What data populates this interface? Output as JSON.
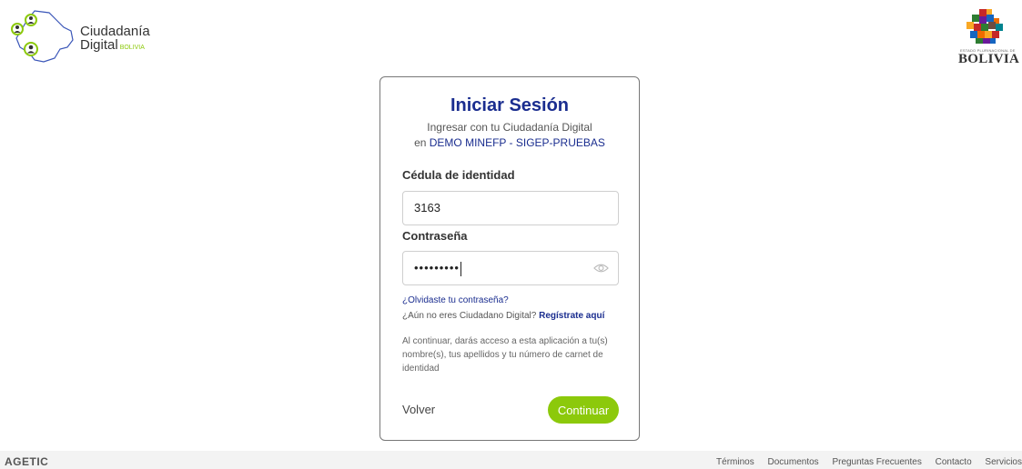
{
  "header": {
    "brand_line1": "Ciudadanía",
    "brand_line2": "Digital",
    "brand_tag": "BOLIVIA",
    "right_logo_small": "ESTADO PLURINACIONAL DE",
    "right_logo_text": "BOLIVIA"
  },
  "login": {
    "title": "Iniciar Sesión",
    "subtitle": "Ingresar con tu Ciudadanía Digital",
    "app_prefix": "en",
    "app_name": "DEMO MINEFP - SIGEP-PRUEBAS",
    "ci_label": "Cédula de identidad",
    "ci_value": "3163",
    "password_label": "Contraseña",
    "password_masked": "•••••••••",
    "forgot_link": "¿Olvidaste tu contraseña?",
    "register_prompt": "¿Aún no eres Ciudadano Digital?",
    "register_link": "Regístrate aquí",
    "consent_text": "Al continuar, darás acceso a esta aplicación a tu(s) nombre(s), tus apellidos y tu número de carnet de identidad",
    "back_label": "Volver",
    "continue_label": "Continuar"
  },
  "footer": {
    "org": "AGETIC",
    "links": [
      "Términos",
      "Documentos",
      "Preguntas Frecuentes",
      "Contacto",
      "Servicios"
    ]
  },
  "colors": {
    "primary": "#1a2d8f",
    "accent": "#8cc90b"
  },
  "icons": {
    "eye": "eye-icon",
    "map": "bolivia-map-icon",
    "users": "user-pin-icon"
  }
}
